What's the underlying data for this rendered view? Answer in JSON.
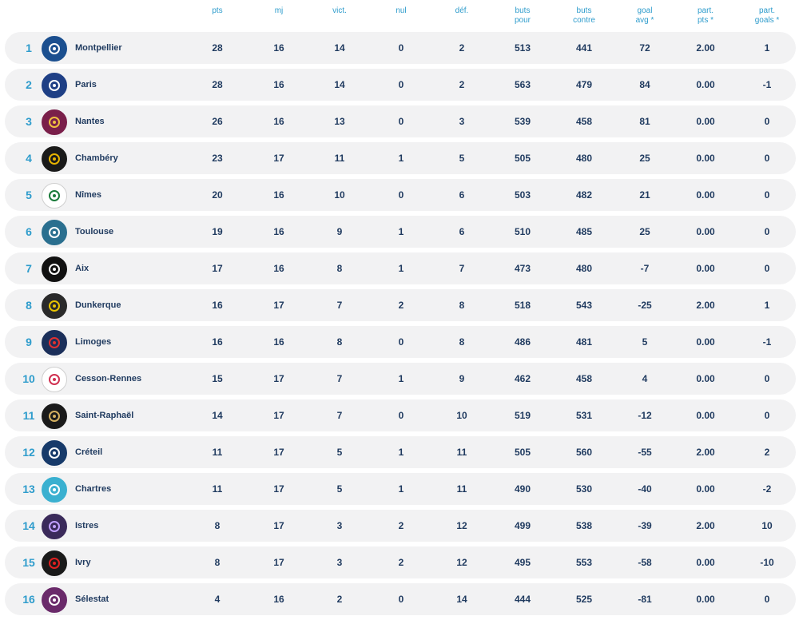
{
  "headers": [
    "pts",
    "mj",
    "vict.",
    "nul",
    "déf.",
    "buts\npour",
    "buts\ncontre",
    "goal\navg *",
    "part.\npts *",
    "part.\ngoals *"
  ],
  "teams": [
    {
      "rank": "1",
      "name": "Montpellier",
      "pts": "28",
      "mj": "16",
      "vict": "14",
      "nul": "0",
      "def": "2",
      "bp": "513",
      "bc": "441",
      "ga": "72",
      "ppts": "2.00",
      "pgoals": "1",
      "logo": {
        "icon": "mhb-logo",
        "bg": "#1b4f8f",
        "fg": "#ffffff"
      }
    },
    {
      "rank": "2",
      "name": "Paris",
      "pts": "28",
      "mj": "16",
      "vict": "14",
      "nul": "0",
      "def": "2",
      "bp": "563",
      "bc": "479",
      "ga": "84",
      "ppts": "0.00",
      "pgoals": "-1",
      "logo": {
        "icon": "psg-logo",
        "bg": "#1e3f85",
        "fg": "#ffffff"
      }
    },
    {
      "rank": "3",
      "name": "Nantes",
      "pts": "26",
      "mj": "16",
      "vict": "13",
      "nul": "0",
      "def": "3",
      "bp": "539",
      "bc": "458",
      "ga": "81",
      "ppts": "0.00",
      "pgoals": "0",
      "logo": {
        "icon": "nantes-logo",
        "bg": "#7a1f4a",
        "fg": "#f0c040"
      }
    },
    {
      "rank": "4",
      "name": "Chambéry",
      "pts": "23",
      "mj": "17",
      "vict": "11",
      "nul": "1",
      "def": "5",
      "bp": "505",
      "bc": "480",
      "ga": "25",
      "ppts": "0.00",
      "pgoals": "0",
      "logo": {
        "icon": "chambery-logo",
        "bg": "#1a1a1a",
        "fg": "#e8b400"
      }
    },
    {
      "rank": "5",
      "name": "Nîmes",
      "pts": "20",
      "mj": "16",
      "vict": "10",
      "nul": "0",
      "def": "6",
      "bp": "503",
      "bc": "482",
      "ga": "21",
      "ppts": "0.00",
      "pgoals": "0",
      "logo": {
        "icon": "usam-logo",
        "bg": "#ffffff",
        "fg": "#1a7a3a"
      }
    },
    {
      "rank": "6",
      "name": "Toulouse",
      "pts": "19",
      "mj": "16",
      "vict": "9",
      "nul": "1",
      "def": "6",
      "bp": "510",
      "bc": "485",
      "ga": "25",
      "ppts": "0.00",
      "pgoals": "0",
      "logo": {
        "icon": "fenix-logo",
        "bg": "#2a6f8f",
        "fg": "#ffffff"
      }
    },
    {
      "rank": "7",
      "name": "Aix",
      "pts": "17",
      "mj": "16",
      "vict": "8",
      "nul": "1",
      "def": "7",
      "bp": "473",
      "bc": "480",
      "ga": "-7",
      "ppts": "0.00",
      "pgoals": "0",
      "logo": {
        "icon": "pauc-logo",
        "bg": "#111111",
        "fg": "#ffffff"
      }
    },
    {
      "rank": "8",
      "name": "Dunkerque",
      "pts": "16",
      "mj": "17",
      "vict": "7",
      "nul": "2",
      "def": "8",
      "bp": "518",
      "bc": "543",
      "ga": "-25",
      "ppts": "2.00",
      "pgoals": "1",
      "logo": {
        "icon": "dunkerque-logo",
        "bg": "#2a2a2a",
        "fg": "#e8c400"
      }
    },
    {
      "rank": "9",
      "name": "Limoges",
      "pts": "16",
      "mj": "16",
      "vict": "8",
      "nul": "0",
      "def": "8",
      "bp": "486",
      "bc": "481",
      "ga": "5",
      "ppts": "0.00",
      "pgoals": "-1",
      "logo": {
        "icon": "limoges-logo",
        "bg": "#1b2f5a",
        "fg": "#e03030"
      }
    },
    {
      "rank": "10",
      "name": "Cesson-Rennes",
      "pts": "15",
      "mj": "17",
      "vict": "7",
      "nul": "1",
      "def": "9",
      "bp": "462",
      "bc": "458",
      "ga": "4",
      "ppts": "0.00",
      "pgoals": "0",
      "logo": {
        "icon": "cesson-logo",
        "bg": "#ffffff",
        "fg": "#d03050"
      }
    },
    {
      "rank": "11",
      "name": "Saint-Raphaël",
      "pts": "14",
      "mj": "17",
      "vict": "7",
      "nul": "0",
      "def": "10",
      "bp": "519",
      "bc": "531",
      "ga": "-12",
      "ppts": "0.00",
      "pgoals": "0",
      "logo": {
        "icon": "saint-raphael-logo",
        "bg": "#1a1a1a",
        "fg": "#d4b060"
      }
    },
    {
      "rank": "12",
      "name": "Créteil",
      "pts": "11",
      "mj": "17",
      "vict": "5",
      "nul": "1",
      "def": "11",
      "bp": "505",
      "bc": "560",
      "ga": "-55",
      "ppts": "2.00",
      "pgoals": "2",
      "logo": {
        "icon": "creteil-logo",
        "bg": "#173a6a",
        "fg": "#ffffff"
      }
    },
    {
      "rank": "13",
      "name": "Chartres",
      "pts": "11",
      "mj": "17",
      "vict": "5",
      "nul": "1",
      "def": "11",
      "bp": "490",
      "bc": "530",
      "ga": "-40",
      "ppts": "0.00",
      "pgoals": "-2",
      "logo": {
        "icon": "chartres-logo",
        "bg": "#3ab0d0",
        "fg": "#ffffff"
      }
    },
    {
      "rank": "14",
      "name": "Istres",
      "pts": "8",
      "mj": "17",
      "vict": "3",
      "nul": "2",
      "def": "12",
      "bp": "499",
      "bc": "538",
      "ga": "-39",
      "ppts": "2.00",
      "pgoals": "10",
      "logo": {
        "icon": "istres-logo",
        "bg": "#3a2a5a",
        "fg": "#c0a0ff"
      }
    },
    {
      "rank": "15",
      "name": "Ivry",
      "pts": "8",
      "mj": "17",
      "vict": "3",
      "nul": "2",
      "def": "12",
      "bp": "495",
      "bc": "553",
      "ga": "-58",
      "ppts": "0.00",
      "pgoals": "-10",
      "logo": {
        "icon": "ivry-logo",
        "bg": "#1a1a1a",
        "fg": "#e02020"
      }
    },
    {
      "rank": "16",
      "name": "Sélestat",
      "pts": "4",
      "mj": "16",
      "vict": "2",
      "nul": "0",
      "def": "14",
      "bp": "444",
      "bc": "525",
      "ga": "-81",
      "ppts": "0.00",
      "pgoals": "0",
      "logo": {
        "icon": "selestat-logo",
        "bg": "#6a2a6a",
        "fg": "#ffffff"
      }
    }
  ]
}
